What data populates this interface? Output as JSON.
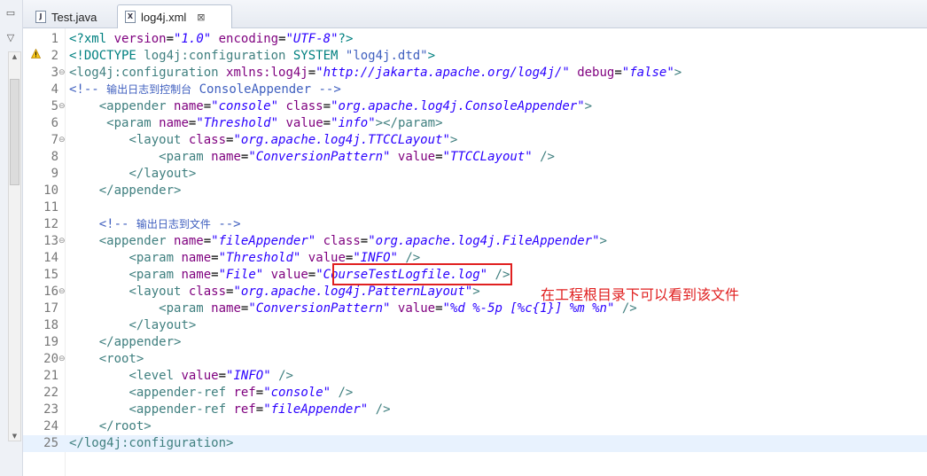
{
  "tabs": [
    {
      "label": "Test.java",
      "icon": "J",
      "active": false
    },
    {
      "label": "log4j.xml",
      "icon": "X",
      "active": true,
      "close": "⊠"
    }
  ],
  "annotation": "在工程根目录下可以看到该文件",
  "editor": {
    "current_line": 25,
    "lines": [
      {
        "n": "1",
        "fold": "",
        "spans": [
          [
            "t-pi",
            "<?xml "
          ],
          [
            "t-attr",
            "version"
          ],
          [
            "t-txt",
            "="
          ],
          [
            "t-val",
            "\"1.0\""
          ],
          [
            "t-txt",
            " "
          ],
          [
            "t-attr",
            "encoding"
          ],
          [
            "t-txt",
            "="
          ],
          [
            "t-val",
            "\"UTF-8\""
          ],
          [
            "t-pi",
            "?>"
          ]
        ]
      },
      {
        "n": "2",
        "fold": "",
        "spans": [
          [
            "t-dt",
            "<!DOCTYPE "
          ],
          [
            "t-tag",
            "log4j:configuration"
          ],
          [
            "t-dt",
            " SYSTEM "
          ],
          [
            "t-cmt",
            "\"log4j.dtd\""
          ],
          [
            "t-dt",
            ">"
          ]
        ]
      },
      {
        "n": "3",
        "fold": "⊖",
        "spans": [
          [
            "t-tag",
            "<log4j:configuration "
          ],
          [
            "t-attr",
            "xmlns:log4j"
          ],
          [
            "t-txt",
            "="
          ],
          [
            "t-val",
            "\"http://jakarta.apache.org/log4j/\""
          ],
          [
            "t-txt",
            " "
          ],
          [
            "t-attr",
            "debug"
          ],
          [
            "t-txt",
            "="
          ],
          [
            "t-val",
            "\"false\""
          ],
          [
            "t-tag",
            ">"
          ]
        ]
      },
      {
        "n": "4",
        "fold": "",
        "spans": [
          [
            "t-cmt",
            "<!-- "
          ],
          [
            "t-cmt t-cjk",
            "输出日志到控制台"
          ],
          [
            "t-cmt",
            " ConsoleAppender -->"
          ]
        ]
      },
      {
        "n": "5",
        "fold": "⊖",
        "spans": [
          [
            "t-txt",
            "    "
          ],
          [
            "t-tag",
            "<appender "
          ],
          [
            "t-attr",
            "name"
          ],
          [
            "t-txt",
            "="
          ],
          [
            "t-val",
            "\"console\""
          ],
          [
            "t-txt",
            " "
          ],
          [
            "t-attr",
            "class"
          ],
          [
            "t-txt",
            "="
          ],
          [
            "t-val",
            "\"org.apache.log4j.ConsoleAppender\""
          ],
          [
            "t-tag",
            ">"
          ]
        ]
      },
      {
        "n": "6",
        "fold": "",
        "spans": [
          [
            "t-txt",
            "     "
          ],
          [
            "t-tag",
            "<param "
          ],
          [
            "t-attr",
            "name"
          ],
          [
            "t-txt",
            "="
          ],
          [
            "t-val",
            "\"Threshold\""
          ],
          [
            "t-txt",
            " "
          ],
          [
            "t-attr",
            "value"
          ],
          [
            "t-txt",
            "="
          ],
          [
            "t-val",
            "\"info\""
          ],
          [
            "t-tag",
            "></param>"
          ]
        ]
      },
      {
        "n": "7",
        "fold": "⊖",
        "spans": [
          [
            "t-txt",
            "        "
          ],
          [
            "t-tag",
            "<layout "
          ],
          [
            "t-attr",
            "class"
          ],
          [
            "t-txt",
            "="
          ],
          [
            "t-val",
            "\"org.apache.log4j.TTCCLayout\""
          ],
          [
            "t-tag",
            ">"
          ]
        ]
      },
      {
        "n": "8",
        "fold": "",
        "spans": [
          [
            "t-txt",
            "            "
          ],
          [
            "t-tag",
            "<param "
          ],
          [
            "t-attr",
            "name"
          ],
          [
            "t-txt",
            "="
          ],
          [
            "t-val",
            "\"ConversionPattern\""
          ],
          [
            "t-txt",
            " "
          ],
          [
            "t-attr",
            "value"
          ],
          [
            "t-txt",
            "="
          ],
          [
            "t-val",
            "\"TTCCLayout\""
          ],
          [
            "t-txt",
            " "
          ],
          [
            "t-tag",
            "/>"
          ]
        ]
      },
      {
        "n": "9",
        "fold": "",
        "spans": [
          [
            "t-txt",
            "        "
          ],
          [
            "t-tag",
            "</layout>"
          ]
        ]
      },
      {
        "n": "10",
        "fold": "",
        "spans": [
          [
            "t-txt",
            "    "
          ],
          [
            "t-tag",
            "</appender>"
          ]
        ]
      },
      {
        "n": "11",
        "fold": "",
        "spans": []
      },
      {
        "n": "12",
        "fold": "",
        "spans": [
          [
            "t-txt",
            "    "
          ],
          [
            "t-cmt",
            "<!-- "
          ],
          [
            "t-cmt t-cjk",
            "输出日志到文件"
          ],
          [
            "t-cmt",
            " -->"
          ]
        ]
      },
      {
        "n": "13",
        "fold": "⊖",
        "spans": [
          [
            "t-txt",
            "    "
          ],
          [
            "t-tag",
            "<appender "
          ],
          [
            "t-attr",
            "name"
          ],
          [
            "t-txt",
            "="
          ],
          [
            "t-val",
            "\"fileAppender\""
          ],
          [
            "t-txt",
            " "
          ],
          [
            "t-attr",
            "class"
          ],
          [
            "t-txt",
            "="
          ],
          [
            "t-val",
            "\"org.apache.log4j.FileAppender\""
          ],
          [
            "t-tag",
            ">"
          ]
        ]
      },
      {
        "n": "14",
        "fold": "",
        "spans": [
          [
            "t-txt",
            "        "
          ],
          [
            "t-tag",
            "<param "
          ],
          [
            "t-attr",
            "name"
          ],
          [
            "t-txt",
            "="
          ],
          [
            "t-val",
            "\"Threshold\""
          ],
          [
            "t-txt",
            " "
          ],
          [
            "t-attr",
            "value"
          ],
          [
            "t-txt",
            "="
          ],
          [
            "t-val",
            "\"INFO\""
          ],
          [
            "t-txt",
            " "
          ],
          [
            "t-tag",
            "/>"
          ]
        ]
      },
      {
        "n": "15",
        "fold": "",
        "spans": [
          [
            "t-txt",
            "        "
          ],
          [
            "t-tag",
            "<param "
          ],
          [
            "t-attr",
            "name"
          ],
          [
            "t-txt",
            "="
          ],
          [
            "t-val",
            "\"File\""
          ],
          [
            "t-txt",
            " "
          ],
          [
            "t-attr",
            "value"
          ],
          [
            "t-txt",
            "="
          ],
          [
            "t-val",
            "\"CourseTestLogfile.log\""
          ],
          [
            "t-txt",
            " "
          ],
          [
            "t-tag",
            "/>"
          ]
        ]
      },
      {
        "n": "16",
        "fold": "⊖",
        "spans": [
          [
            "t-txt",
            "        "
          ],
          [
            "t-tag",
            "<layout "
          ],
          [
            "t-attr",
            "class"
          ],
          [
            "t-txt",
            "="
          ],
          [
            "t-val",
            "\"org.apache.log4j.PatternLayout\""
          ],
          [
            "t-tag",
            ">"
          ]
        ]
      },
      {
        "n": "17",
        "fold": "",
        "spans": [
          [
            "t-txt",
            "            "
          ],
          [
            "t-tag",
            "<param "
          ],
          [
            "t-attr",
            "name"
          ],
          [
            "t-txt",
            "="
          ],
          [
            "t-val",
            "\"ConversionPattern\""
          ],
          [
            "t-txt",
            " "
          ],
          [
            "t-attr",
            "value"
          ],
          [
            "t-txt",
            "="
          ],
          [
            "t-val",
            "\"%d %-5p [%c{1}] %m %n\""
          ],
          [
            "t-txt",
            " "
          ],
          [
            "t-tag",
            "/>"
          ]
        ]
      },
      {
        "n": "18",
        "fold": "",
        "spans": [
          [
            "t-txt",
            "        "
          ],
          [
            "t-tag",
            "</layout>"
          ]
        ]
      },
      {
        "n": "19",
        "fold": "",
        "spans": [
          [
            "t-txt",
            "    "
          ],
          [
            "t-tag",
            "</appender>"
          ]
        ]
      },
      {
        "n": "20",
        "fold": "⊖",
        "spans": [
          [
            "t-txt",
            "    "
          ],
          [
            "t-tag",
            "<root>"
          ]
        ]
      },
      {
        "n": "21",
        "fold": "",
        "spans": [
          [
            "t-txt",
            "        "
          ],
          [
            "t-tag",
            "<level "
          ],
          [
            "t-attr",
            "value"
          ],
          [
            "t-txt",
            "="
          ],
          [
            "t-val",
            "\"INFO\""
          ],
          [
            "t-txt",
            " "
          ],
          [
            "t-tag",
            "/>"
          ]
        ]
      },
      {
        "n": "22",
        "fold": "",
        "spans": [
          [
            "t-txt",
            "        "
          ],
          [
            "t-tag",
            "<appender-ref "
          ],
          [
            "t-attr",
            "ref"
          ],
          [
            "t-txt",
            "="
          ],
          [
            "t-val",
            "\"console\""
          ],
          [
            "t-txt",
            " "
          ],
          [
            "t-tag",
            "/>"
          ]
        ]
      },
      {
        "n": "23",
        "fold": "",
        "spans": [
          [
            "t-txt",
            "        "
          ],
          [
            "t-tag",
            "<appender-ref "
          ],
          [
            "t-attr",
            "ref"
          ],
          [
            "t-txt",
            "="
          ],
          [
            "t-val",
            "\"fileAppender\""
          ],
          [
            "t-txt",
            " "
          ],
          [
            "t-tag",
            "/>"
          ]
        ]
      },
      {
        "n": "24",
        "fold": "",
        "spans": [
          [
            "t-txt",
            "    "
          ],
          [
            "t-tag",
            "</root>"
          ]
        ]
      },
      {
        "n": "25",
        "fold": "",
        "spans": [
          [
            "t-tag",
            "</log4j:configuration>"
          ]
        ]
      }
    ]
  }
}
